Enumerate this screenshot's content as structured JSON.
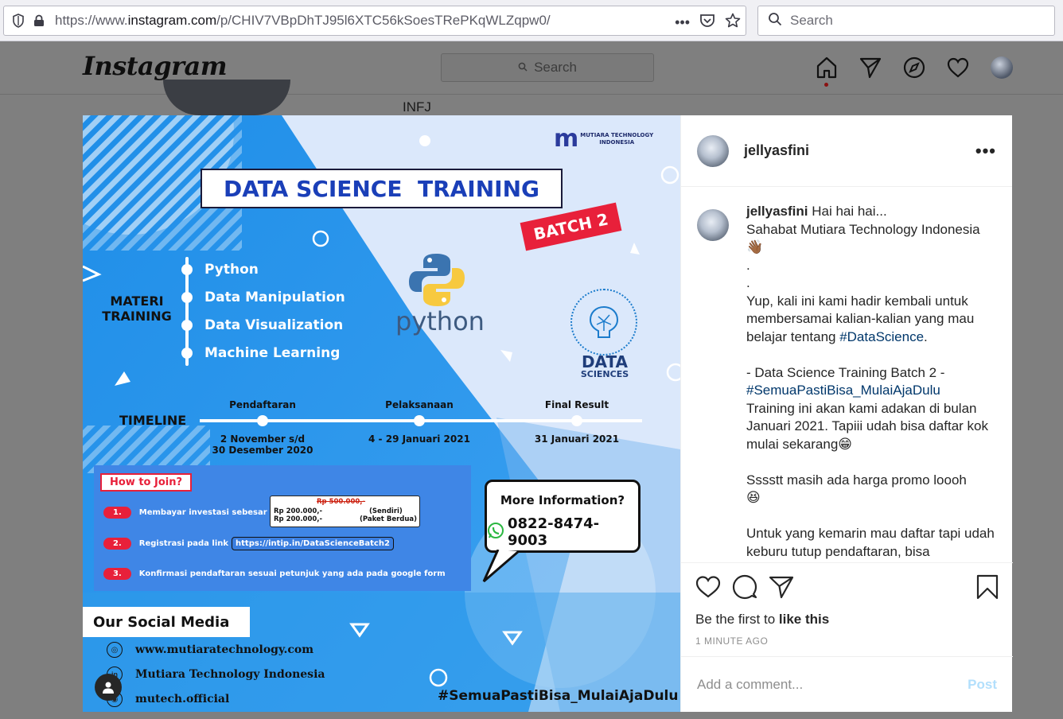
{
  "browser": {
    "url_prefix": "https://www.",
    "url_domain": "instagram.com",
    "url_path": "/p/CHIV7VBpDhTJ95l6XTC56kSoesTRePKqWLZqpw0/",
    "search_placeholder": "Search"
  },
  "instagram": {
    "logo": "Instagram",
    "search_placeholder": "Search",
    "bg_text": "INFJ"
  },
  "post": {
    "username": "jellyasfini",
    "caption_user": "jellyasfini",
    "caption_lines": [
      " Hai hai hai...\nSahabat Mutiara Technology Indonesia\n👋🏾\n.\n.\nYup, kali ini kami hadir kembali untuk membersamai kalian-kalian yang mau belajar tentang ",
      "#DataScience",
      ".\n\n- Data Science Training Batch 2 -\n",
      "#SemuaPastiBisa_MulaiAjaDulu",
      "\nTraining ini akan kami adakan di bulan Januari 2021. Tapiii udah bisa daftar kok mulai sekarang😁\n\nSssstt masih ada harga promo loooh\n😆\n\nUntuk yang kemarin mau daftar tapi udah keburu tutup pendaftaran, bisa"
    ],
    "likes_prefix": "Be the first to ",
    "likes_link": "like this",
    "time": "1 MINUTE AGO",
    "comment_placeholder": "Add a comment...",
    "post_label": "Post"
  },
  "poster": {
    "brand": "MUTIARA TECHNOLOGY\nINDONESIA",
    "title": "DATA SCIENCE  TRAINING",
    "batch": "BATCH 2",
    "materi_label": "MATERI\nTRAINING",
    "materi": [
      "Python",
      "Data Manipulation",
      "Data Visualization",
      "Machine Learning"
    ],
    "python_word": "python",
    "ds_word": "DATA",
    "ds_sub": "SCIENCES",
    "timeline_label": "TIMELINE",
    "timeline": [
      {
        "head": "Pendaftaran",
        "date": "2 November s/d\n30 Desember 2020"
      },
      {
        "head": "Pelaksanaan",
        "date": "4 - 29 Januari 2021"
      },
      {
        "head": "Final Result",
        "date": "31 Januari 2021"
      }
    ],
    "how_title": "How to Join?",
    "steps": [
      {
        "num": "1.",
        "text": "Membayar investasi sebesar"
      },
      {
        "num": "2.",
        "text": "Registrasi pada link"
      },
      {
        "num": "3.",
        "text": "Konfirmasi pendaftaran sesuai petunjuk yang ada pada google form"
      }
    ],
    "price_strike": "Rp 500.000,-",
    "price1": "Rp 200.000,-",
    "price1_note": "(Sendiri)",
    "price2": "Rp 200.000,-",
    "price2_note": "(Paket Berdua)",
    "link": "https://intip.in/DataScienceBatch2",
    "more_info": "More Information?",
    "phone": "0822-8474-9003",
    "social_title": "Our Social Media",
    "socials": [
      "www.mutiaratechnology.com",
      "Mutiara Technology Indonesia",
      "mutech.official"
    ],
    "hashtag": "#SemuaPastiBisa_MulaiAjaDulu"
  }
}
